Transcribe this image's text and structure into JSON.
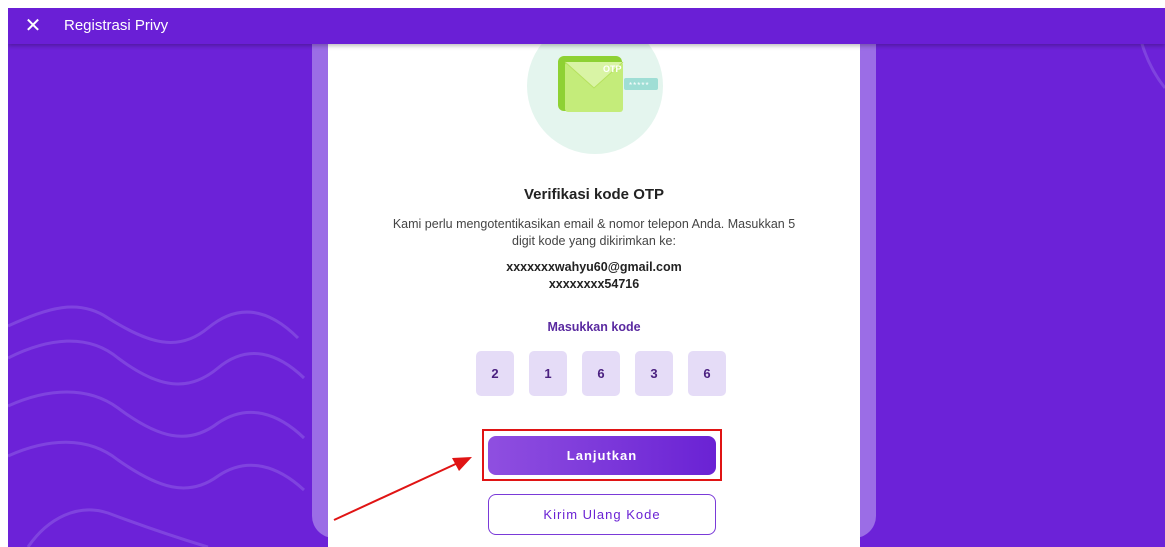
{
  "topbar": {
    "title": "Registrasi Privy",
    "close_icon": "close-icon"
  },
  "illustration": {
    "label": "OTP",
    "masked": "*****"
  },
  "verification": {
    "title": "Verifikasi kode OTP",
    "description": "Kami perlu mengotentikasikan email & nomor telepon Anda. Masukkan 5 digit kode yang dikirimkan ke:",
    "email": "xxxxxxxwahyu60@gmail.com",
    "phone": "xxxxxxxx54716"
  },
  "otp": {
    "label": "Masukkan kode",
    "digits": [
      "2",
      "1",
      "6",
      "3",
      "6"
    ]
  },
  "buttons": {
    "continue": "Lanjutkan",
    "resend": "Kirim Ulang Kode"
  },
  "colors": {
    "background": "#6c22d8",
    "accent": "#6a22d4",
    "highlight": "#e01414"
  }
}
